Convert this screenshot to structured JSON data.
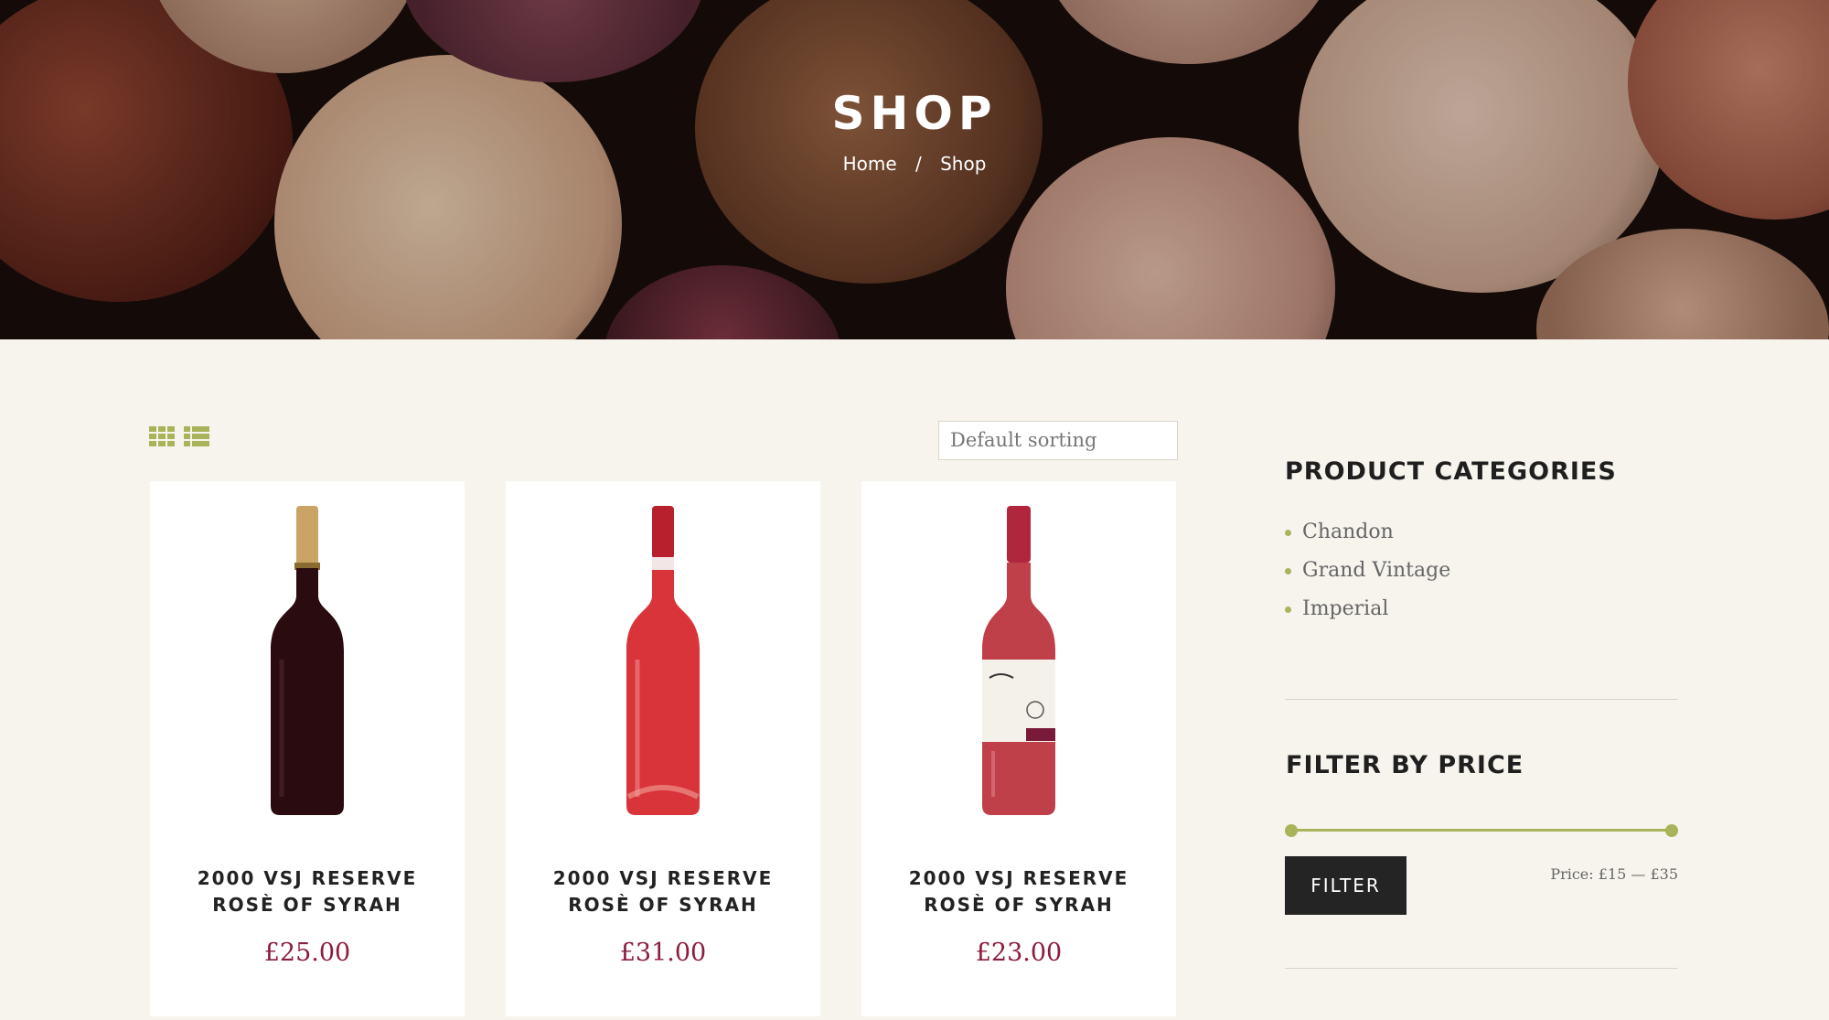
{
  "hero": {
    "title": "SHOP",
    "breadcrumb": {
      "home": "Home",
      "separator": "/",
      "current": "Shop"
    }
  },
  "toolbar": {
    "sort_value": "Default sorting",
    "view_icons": [
      "grid-view-icon",
      "list-view-icon"
    ]
  },
  "products": [
    {
      "name": "2000 VSJ RESERVE ROSÈ OF SYRAH",
      "price": "£25.00",
      "bottle_color": "#2a0c10",
      "cap_color": "#c9a464"
    },
    {
      "name": "2000 VSJ RESERVE ROSÈ OF SYRAH",
      "price": "£31.00",
      "bottle_color": "#d8343a",
      "cap_color": "#b8202e"
    },
    {
      "name": "2000 VSJ RESERVE ROSÈ OF SYRAH",
      "price": "£23.00",
      "bottle_color": "#c0404a",
      "cap_color": "#b0263c"
    }
  ],
  "sidebar": {
    "categories_title": "PRODUCT CATEGORIES",
    "categories": [
      "Chandon",
      "Grand Vintage",
      "Imperial"
    ],
    "price_title": "FILTER BY PRICE",
    "filter_label": "FILTER",
    "price_range_text": "Price: £15 — £35"
  },
  "colors": {
    "accent": "#a9b35a",
    "price": "#8b1d3d",
    "button": "#242424",
    "background": "#f7f4ee"
  }
}
